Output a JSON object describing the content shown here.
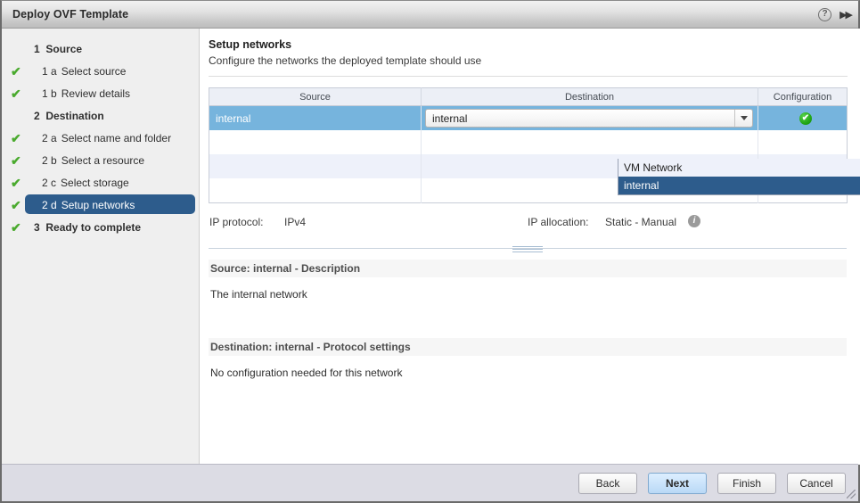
{
  "window": {
    "title": "Deploy OVF Template",
    "help_icon": "help-circle-icon",
    "collapse_icon": "double-chevron-right-icon"
  },
  "sidebar": {
    "items": [
      {
        "check": "",
        "num": "1",
        "label": "Source",
        "type": "group",
        "selected": false
      },
      {
        "check": "✔",
        "num": "1 a",
        "label": "Select source",
        "type": "sub",
        "selected": false
      },
      {
        "check": "✔",
        "num": "1 b",
        "label": "Review details",
        "type": "sub",
        "selected": false
      },
      {
        "check": "",
        "num": "2",
        "label": "Destination",
        "type": "group",
        "selected": false
      },
      {
        "check": "✔",
        "num": "2 a",
        "label": "Select name and folder",
        "type": "sub",
        "selected": false
      },
      {
        "check": "✔",
        "num": "2 b",
        "label": "Select a resource",
        "type": "sub",
        "selected": false
      },
      {
        "check": "✔",
        "num": "2 c",
        "label": "Select storage",
        "type": "sub",
        "selected": false
      },
      {
        "check": "✔",
        "num": "2 d",
        "label": "Setup networks",
        "type": "sub",
        "selected": true
      },
      {
        "check": "✔",
        "num": "3",
        "label": "Ready to complete",
        "type": "group",
        "selected": false
      }
    ]
  },
  "page": {
    "title": "Setup networks",
    "subtitle": "Configure the networks the deployed template should use"
  },
  "table": {
    "columns": [
      "Source",
      "Destination",
      "Configuration"
    ],
    "rows": [
      {
        "source": "internal",
        "destination": "internal",
        "configuration": "✔",
        "selected": true
      },
      {
        "source": "",
        "destination": "",
        "configuration": "",
        "selected": false
      },
      {
        "source": "",
        "destination": "",
        "configuration": "",
        "selected": false
      },
      {
        "source": "",
        "destination": "",
        "configuration": "",
        "selected": false
      }
    ]
  },
  "dropdown": {
    "selected_value": "internal",
    "open": true,
    "options": [
      {
        "label": "VM Network",
        "selected": false
      },
      {
        "label": "internal",
        "selected": true
      }
    ]
  },
  "ip_settings": {
    "protocol_label": "IP protocol:",
    "protocol_value": "IPv4",
    "allocation_label": "IP allocation:",
    "allocation_value": "Static - Manual",
    "info_icon": "info-circle-icon"
  },
  "details": {
    "source": {
      "heading": "Source: internal - Description",
      "body": "The internal network"
    },
    "destination": {
      "heading": "Destination: internal - Protocol settings",
      "body": "No configuration needed for this network"
    }
  },
  "footer": {
    "back": "Back",
    "next": "Next",
    "finish": "Finish",
    "cancel": "Cancel"
  },
  "colors": {
    "accent_blue": "#2d5c8c",
    "row_selected": "#76b4dd",
    "check_green": "#4aaa2e",
    "primary_button": "#cbe4fb",
    "footer_bg": "#dcdce4",
    "sidebar_bg": "#efefef"
  }
}
